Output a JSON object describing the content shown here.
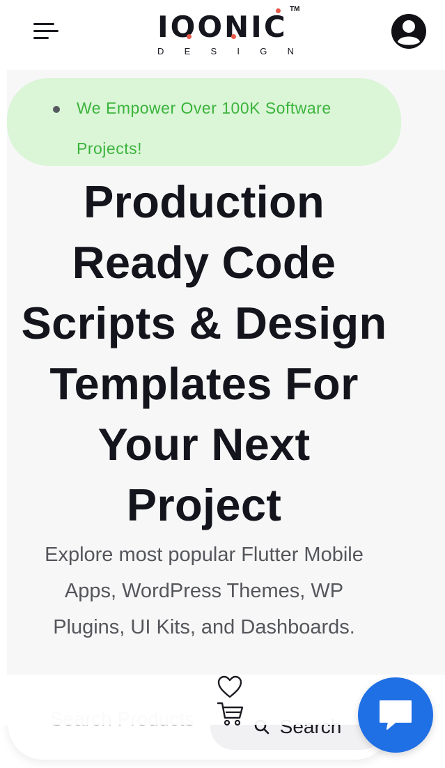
{
  "header": {
    "logo_text": "IOONIC",
    "logo_tm": "TM",
    "logo_sub": [
      "D",
      "E",
      "S",
      "I",
      "G",
      "N"
    ],
    "icons": {
      "menu": "menu-icon",
      "account": "account-icon"
    }
  },
  "hero": {
    "badge_text": "We Empower Over 100K Software Projects!",
    "title_lines": [
      "Production",
      "Ready Code",
      "Scripts & Design",
      "Templates For",
      "Your Next",
      "Project"
    ],
    "subtitle_lines": [
      "Explore most popular Flutter Mobile",
      "Apps, WordPress Themes, WP",
      "Plugins, UI Kits, and Dashboards."
    ]
  },
  "search": {
    "placeholder": "Search Products",
    "button_label": "Search"
  },
  "floating": {
    "wishlist_icon": "heart-icon",
    "cart_icon": "cart-icon",
    "chat_icon": "chat-icon"
  },
  "colors": {
    "badge_bg": "#dbf5d7",
    "badge_text": "#3bb43c",
    "chat_button": "#1f6fe5",
    "logo_dot": "#e95b4b"
  }
}
